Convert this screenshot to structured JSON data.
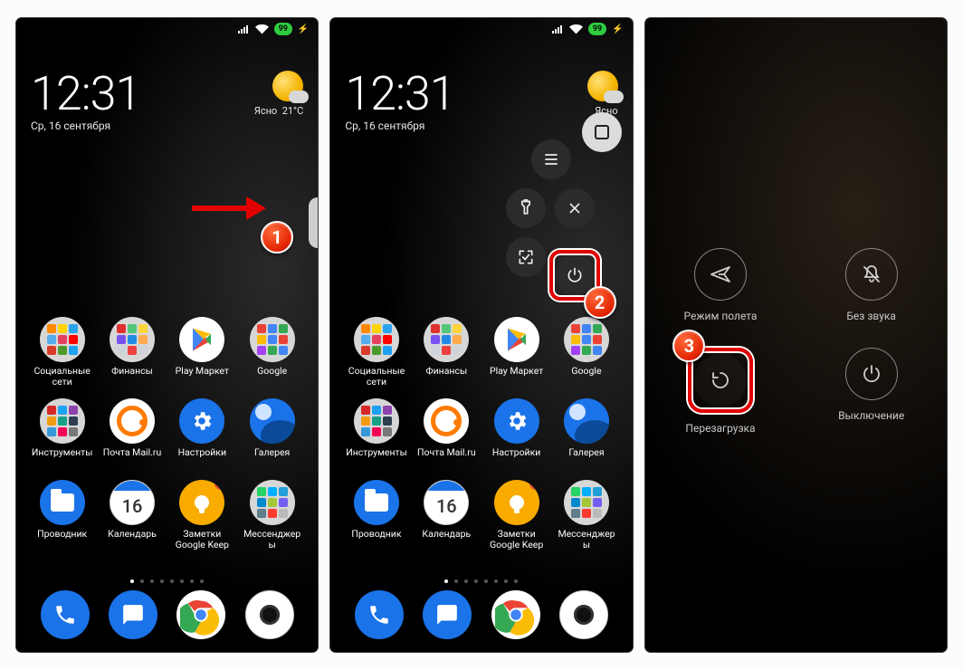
{
  "status": {
    "battery": "99"
  },
  "clock": {
    "time": "12:31",
    "date": "Ср, 16 сентября"
  },
  "weather": {
    "cond": "Ясно",
    "temp": "21°C"
  },
  "badges": {
    "b1": "1",
    "b2": "2",
    "b3": "3"
  },
  "apps": {
    "row1": [
      {
        "label": "Социальные сети"
      },
      {
        "label": "Финансы"
      },
      {
        "label": "Play Маркет"
      },
      {
        "label": "Google"
      }
    ],
    "row2": [
      {
        "label": "Инструменты"
      },
      {
        "label": "Почта Mail.ru"
      },
      {
        "label": "Настройки"
      },
      {
        "label": "Галерея"
      }
    ],
    "row3": [
      {
        "label": "Проводник"
      },
      {
        "label": "Календарь",
        "day": "16"
      },
      {
        "label": "Заметки Google Keep",
        "notif": "1"
      },
      {
        "label": "Мессенджеры"
      }
    ]
  },
  "quickball": {
    "home": "home-icon",
    "menu": "menu-icon",
    "torch": "flashlight-icon",
    "close": "close-icon",
    "screenshot": "screenshot-icon",
    "power": "power-icon"
  },
  "powermenu": {
    "airplane": "Режим полета",
    "silent": "Без звука",
    "reboot": "Перезагрузка",
    "shutdown": "Выключение"
  },
  "folder_colors": {
    "social": [
      "#ff8a00",
      "#ffd400",
      "#2aa3ef",
      "#55acee",
      "#e4405f",
      "#ff0000",
      "#d93c2b",
      "#4c9a2a",
      "#1da1f2"
    ],
    "finance": [
      "#e03131",
      "#55c57a",
      "#ffd43b",
      "#7950f2",
      "#228be6",
      "#ffa94d",
      "#ced4da",
      "#f03e3e",
      "#ced4da"
    ],
    "google": [
      "#ea4335",
      "#4285f4",
      "#34a853",
      "#fbbc05",
      "#4285f4",
      "#ea4335",
      "#a142f4",
      "#34a853",
      "#4285f4"
    ],
    "tools": [
      "#d62828",
      "#1da1f2",
      "#8e44ad",
      "#f39c12",
      "#16a085",
      "#2c3e50",
      "#3498db",
      "#f50057",
      "#777777"
    ],
    "msgr": [
      "#25d366",
      "#00b0ff",
      "#229ed9",
      "#0088cc",
      "#a4c639",
      "#7360f2",
      "#607d8b",
      "#ff3b30",
      "#bbbbbb"
    ]
  }
}
